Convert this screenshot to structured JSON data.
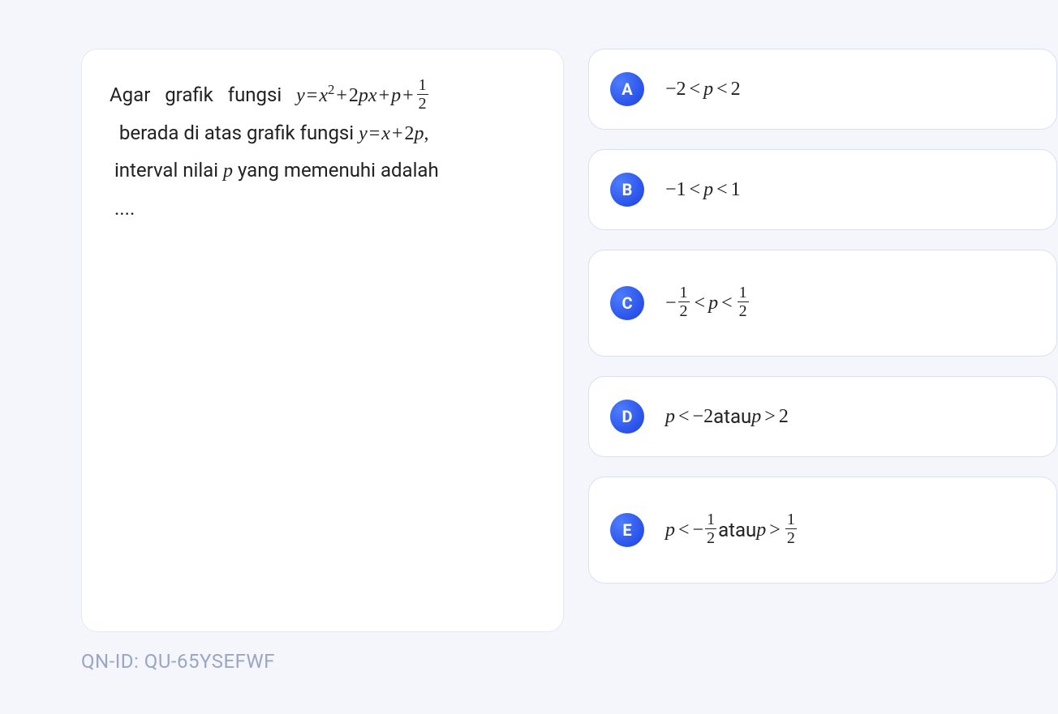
{
  "question": {
    "t1": "Agar",
    "t2": "grafik",
    "t3": "fungsi",
    "eq1_y": "y",
    "eq1_eq": "=",
    "eq1_x": "x",
    "eq1_sq": "2",
    "eq1_p1": "+",
    "eq1_2": "2",
    "eq1_p": "p",
    "eq1_x2": "x",
    "eq1_p2": "+",
    "eq1_p3": "p",
    "eq1_p4": "+",
    "eq1_fnum": "1",
    "eq1_fden": "2",
    "t4": "berada di atas grafik fungsi",
    "eq2_y": "y",
    "eq2_eq": "=",
    "eq2_x": "x",
    "eq2_p": "+",
    "eq2_2": "2",
    "eq2_p2": "p",
    "eq2_comma": ",",
    "t5": "interval nilai",
    "t5_p": "p",
    "t6": "yang memenuhi adalah",
    "dots": "...."
  },
  "answers": {
    "A": {
      "letter": "A",
      "m2": "−2",
      "lt1": "<",
      "p": "p",
      "lt2": "<",
      "r": "2"
    },
    "B": {
      "letter": "B",
      "m1": "−1",
      "lt1": "<",
      "p": "p",
      "lt2": "<",
      "r": "1"
    },
    "C": {
      "letter": "C",
      "neg": "−",
      "f1n": "1",
      "f1d": "2",
      "lt1": "<",
      "p": "p",
      "lt2": "<",
      "f2n": "1",
      "f2d": "2"
    },
    "D": {
      "letter": "D",
      "p1": "p",
      "lt1": "<",
      "m2": "−2",
      "atau": " atau ",
      "p2": "p",
      "gt": ">",
      "r": "2"
    },
    "E": {
      "letter": "E",
      "p1": "p",
      "lt1": "<",
      "neg": "−",
      "f1n": "1",
      "f1d": "2",
      "atau": " atau ",
      "p2": "p",
      "gt": ">",
      "f2n": "1",
      "f2d": "2"
    }
  },
  "qnid": "QN-ID: QU-65YSEFWF"
}
